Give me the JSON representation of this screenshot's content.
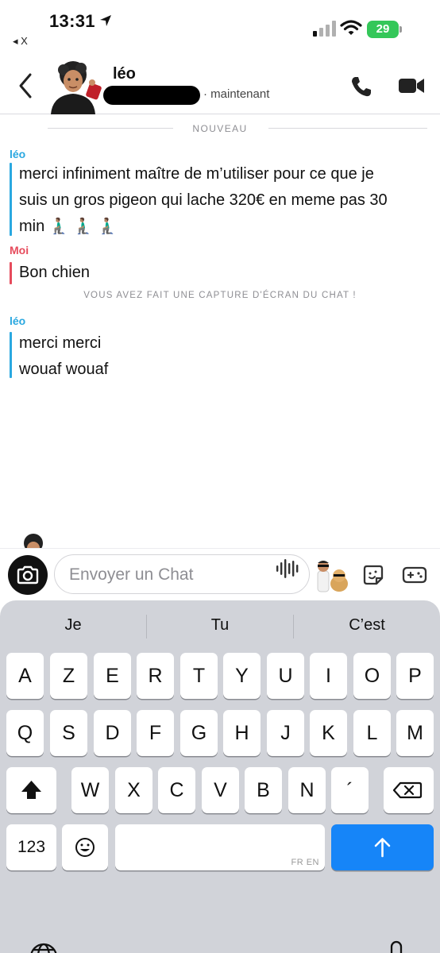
{
  "status_bar": {
    "time": "13:31",
    "back_app": "◂ X",
    "battery": "29"
  },
  "header": {
    "contact_name": "léo",
    "presence": "· maintenant"
  },
  "divider": {
    "label": "NOUVEAU"
  },
  "messages": [
    {
      "sender": "léo",
      "lines": [
        "merci infiniment maître de m’utiliser pour ce que je",
        "suis un gros pigeon qui lache 320€ en meme pas 30",
        "min 🧎🏽‍♂️ 🧎🏽‍♂️ 🧎🏽‍♂️"
      ]
    },
    {
      "sender": "Moi",
      "lines": [
        "Bon chien"
      ]
    },
    {
      "sender": "léo",
      "lines": [
        "merci merci",
        "wouaf wouaf"
      ]
    }
  ],
  "screenshot_notice": "VOUS AVEZ FAIT UNE CAPTURE D'ÉCRAN DU CHAT !",
  "input": {
    "placeholder": "Envoyer un Chat"
  },
  "keyboard": {
    "suggestions": [
      "Je",
      "Tu",
      "C’est"
    ],
    "row1": [
      "A",
      "Z",
      "E",
      "R",
      "T",
      "Y",
      "U",
      "I",
      "O",
      "P"
    ],
    "row2": [
      "Q",
      "S",
      "D",
      "F",
      "G",
      "H",
      "J",
      "K",
      "L",
      "M"
    ],
    "row3": [
      "W",
      "X",
      "C",
      "V",
      "B",
      "N",
      "´"
    ],
    "numbers_label": "123",
    "language_label": "FR EN"
  },
  "colors": {
    "leo": "#2aa8e0",
    "me": "#e64b5c",
    "send": "#1685f8",
    "battery": "#34c759"
  }
}
